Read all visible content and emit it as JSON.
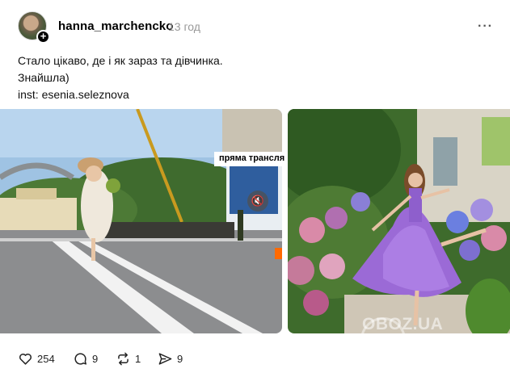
{
  "header": {
    "username": "hanna_marchencko",
    "time": "13 год",
    "more_label": "···",
    "avatar_plus": "+"
  },
  "post": {
    "lines": [
      "Стало цікаво, де і як зараз та дівчинка.",
      "Знайшла)",
      "inst: esenia.seleznova"
    ]
  },
  "media": {
    "live_label": "пряма трансля",
    "mute_icon": "speaker-muted-icon",
    "watermark": "OBOZ.UA"
  },
  "actions": {
    "likes": "254",
    "replies": "9",
    "reposts": "1",
    "shares": "9"
  },
  "colors": {
    "accent_live": "#ff6a00",
    "dress": "#9b6ad6",
    "muted_text": "#999999"
  }
}
